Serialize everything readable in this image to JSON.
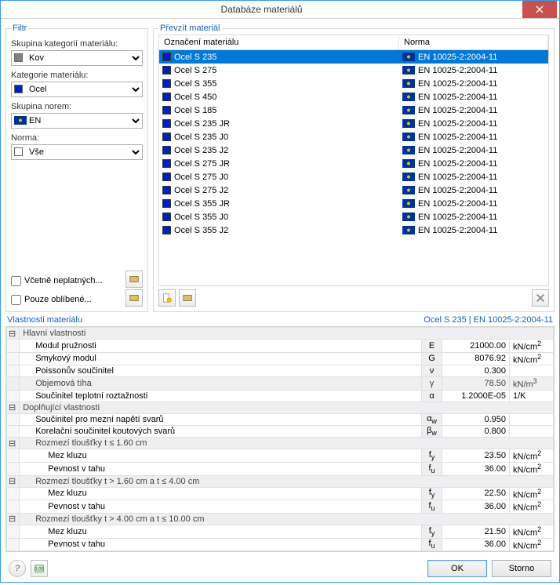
{
  "title": "Databáze materiálů",
  "filter": {
    "legend": "Filtr",
    "group_label": "Skupina kategorií materiálu:",
    "group_value": "Kov",
    "cat_label": "Kategorie materiálu:",
    "cat_value": "Ocel",
    "norm_group_label": "Skupina norem:",
    "norm_group_value": "EN",
    "norm_label": "Norma:",
    "norm_value": "Vše",
    "include_invalid": "Včetně neplatných...",
    "favorites_only": "Pouze oblíbené..."
  },
  "list": {
    "legend": "Převzít materiál",
    "col1": "Označení materiálu",
    "col2": "Norma",
    "rows": [
      {
        "name": "Ocel S 235",
        "norm": "EN 10025-2:2004-11",
        "sel": true
      },
      {
        "name": "Ocel S 275",
        "norm": "EN 10025-2:2004-11"
      },
      {
        "name": "Ocel S 355",
        "norm": "EN 10025-2:2004-11"
      },
      {
        "name": "Ocel S 450",
        "norm": "EN 10025-2:2004-11"
      },
      {
        "name": "Ocel S 185",
        "norm": "EN 10025-2:2004-11"
      },
      {
        "name": "Ocel S 235 JR",
        "norm": "EN 10025-2:2004-11"
      },
      {
        "name": "Ocel S 235 J0",
        "norm": "EN 10025-2:2004-11"
      },
      {
        "name": "Ocel S 235 J2",
        "norm": "EN 10025-2:2004-11"
      },
      {
        "name": "Ocel S 275 JR",
        "norm": "EN 10025-2:2004-11"
      },
      {
        "name": "Ocel S 275 J0",
        "norm": "EN 10025-2:2004-11"
      },
      {
        "name": "Ocel S 275 J2",
        "norm": "EN 10025-2:2004-11"
      },
      {
        "name": "Ocel S 355 JR",
        "norm": "EN 10025-2:2004-11"
      },
      {
        "name": "Ocel S 355 J0",
        "norm": "EN 10025-2:2004-11"
      },
      {
        "name": "Ocel S 355 J2",
        "norm": "EN 10025-2:2004-11"
      }
    ]
  },
  "props": {
    "legend": "Vlastnosti materiálu",
    "current": "Ocel S 235  |  EN 10025-2:2004-11",
    "r": {
      "main": "Hlavní vlastnosti",
      "e": {
        "n": "Modul pružnosti",
        "s": "E",
        "v": "21000.00",
        "u": "kN/cm"
      },
      "g": {
        "n": "Smykový modul",
        "s": "G",
        "v": "8076.92",
        "u": "kN/cm"
      },
      "nu": {
        "n": "Poissonův součinitel",
        "s": "ν",
        "v": "0.300",
        "u": ""
      },
      "gamma": {
        "n": "Objemová tíha",
        "s": "γ",
        "v": "78.50",
        "u": "kN/m"
      },
      "alpha": {
        "n": "Součinitel teplotní roztažnosti",
        "s": "α",
        "v": "1.2000E-05",
        "u": "1/K"
      },
      "add": "Doplňující vlastnosti",
      "aw": {
        "n": "Součinitel pro mezní napětí svarů",
        "s": "α",
        "sub": "w",
        "v": "0.950",
        "u": ""
      },
      "bw": {
        "n": "Korelační součinitel koutových svarů",
        "s": "β",
        "sub": "w",
        "v": "0.800",
        "u": ""
      },
      "t1": "Rozmezí tloušťky t ≤ 1.60 cm",
      "t1fy": {
        "n": "Mez kluzu",
        "s": "f",
        "sub": "y",
        "v": "23.50",
        "u": "kN/cm"
      },
      "t1fu": {
        "n": "Pevnost v tahu",
        "s": "f",
        "sub": "u",
        "v": "36.00",
        "u": "kN/cm"
      },
      "t2": "Rozmezí tloušťky t > 1.60 cm a t ≤ 4.00 cm",
      "t2fy": {
        "n": "Mez kluzu",
        "s": "f",
        "sub": "y",
        "v": "22.50",
        "u": "kN/cm"
      },
      "t2fu": {
        "n": "Pevnost v tahu",
        "s": "f",
        "sub": "u",
        "v": "36.00",
        "u": "kN/cm"
      },
      "t3": "Rozmezí tloušťky t > 4.00 cm a t ≤ 10.00 cm",
      "t3fy": {
        "n": "Mez kluzu",
        "s": "f",
        "sub": "y",
        "v": "21.50",
        "u": "kN/cm"
      },
      "t3fu": {
        "n": "Pevnost v tahu",
        "s": "f",
        "sub": "u",
        "v": "36.00",
        "u": "kN/cm"
      }
    }
  },
  "buttons": {
    "ok": "OK",
    "cancel": "Storno"
  }
}
